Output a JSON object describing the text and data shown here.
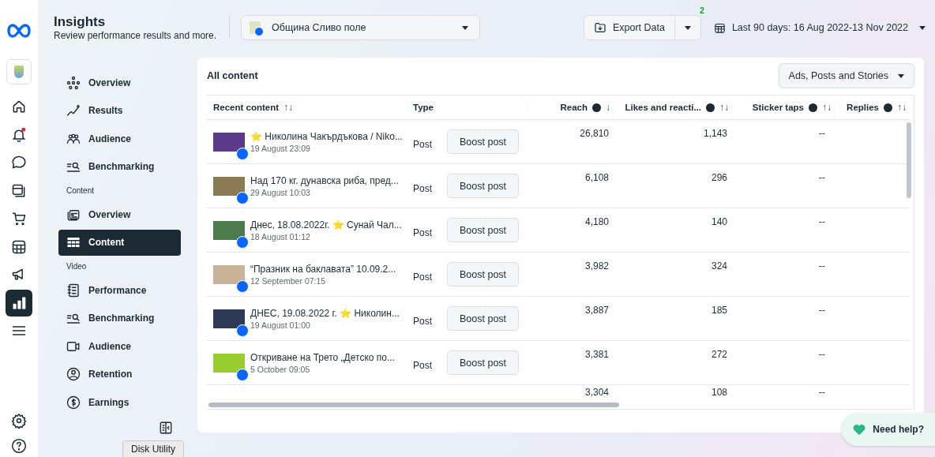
{
  "header": {
    "title": "Insights",
    "subtitle": "Review performance results and more.",
    "page_selector": "Община Сливо поле",
    "export_button": "Export Data",
    "export_badge": "2",
    "date_range": "Last 90 days: 16 Aug 2022-13 Nov 2022"
  },
  "rail": [
    {
      "kind": "logo",
      "selected": false
    },
    {
      "kind": "avatar",
      "selected": false
    },
    {
      "kind": "home",
      "selected": false
    },
    {
      "kind": "bell",
      "selected": false
    },
    {
      "kind": "chat",
      "selected": false
    },
    {
      "kind": "pages",
      "selected": false
    },
    {
      "kind": "cart",
      "selected": false
    },
    {
      "kind": "grid",
      "selected": false
    },
    {
      "kind": "megaphone",
      "selected": false
    },
    {
      "kind": "chart",
      "selected": true
    },
    {
      "kind": "menu",
      "selected": false
    }
  ],
  "rail_bottom": [
    {
      "kind": "settings"
    },
    {
      "kind": "help"
    }
  ],
  "sidebar": {
    "groups": [
      {
        "items": [
          {
            "label": "Overview",
            "selected": false
          },
          {
            "label": "Results",
            "selected": false
          },
          {
            "label": "Audience",
            "selected": false
          },
          {
            "label": "Benchmarking",
            "selected": false
          }
        ]
      },
      {
        "heading": "Content",
        "items": [
          {
            "label": "Overview",
            "selected": false
          },
          {
            "label": "Content",
            "selected": true
          }
        ]
      },
      {
        "heading": "Video",
        "items": [
          {
            "label": "Performance",
            "selected": false
          },
          {
            "label": "Benchmarking",
            "selected": false
          },
          {
            "label": "Audience",
            "selected": false
          },
          {
            "label": "Retention",
            "selected": false
          },
          {
            "label": "Earnings",
            "selected": false
          }
        ]
      }
    ]
  },
  "content": {
    "title": "All content",
    "filter": "Ads, Posts and Stories",
    "columns": [
      {
        "label": "Recent content",
        "info": false,
        "sort": "↑↓",
        "sorted": false
      },
      {
        "label": "Type",
        "info": false
      },
      {
        "label": "Reach",
        "info": true,
        "sort": "↓",
        "sorted": true
      },
      {
        "label": "Likes and reacti...",
        "info": true,
        "sort": "↑↓",
        "sorted": false
      },
      {
        "label": "Sticker taps",
        "info": true,
        "sort": "↑↓",
        "sorted": false
      },
      {
        "label": "Replies",
        "info": true,
        "sort": "↑↓",
        "sorted": false
      }
    ],
    "rows": [
      {
        "title": "⭐ Николина Чакърдъкова / Niko...",
        "date": "19 August 23:09",
        "type": "Post",
        "action": "Boost post",
        "reach": "26,810",
        "likes": "1,143",
        "sticker_taps": "--"
      },
      {
        "title": "Над 170 кг. дунавска риба, пред...",
        "date": "29 August 10:03",
        "type": "Post",
        "action": "Boost post",
        "reach": "6,108",
        "likes": "296",
        "sticker_taps": "--"
      },
      {
        "title": "Днес, 18.08.2022г. ⭐ Сунай Чал...",
        "date": "18 August 01:12",
        "type": "Post",
        "action": "Boost post",
        "reach": "4,180",
        "likes": "140",
        "sticker_taps": "--"
      },
      {
        "title": "“Празник на баклавата” 10.09.2...",
        "date": "12 September 07:15",
        "type": "Post",
        "action": "Boost post",
        "reach": "3,982",
        "likes": "324",
        "sticker_taps": "--"
      },
      {
        "title": "ДНЕС, 19.08.2022 г. ⭐ Николин...",
        "date": "19 August 01:00",
        "type": "Post",
        "action": "Boost post",
        "reach": "3,887",
        "likes": "185",
        "sticker_taps": "--"
      },
      {
        "title": "Откриване на Трето „Детско по...",
        "date": "5 October 09:05",
        "type": "Post",
        "action": "Boost post",
        "reach": "3,381",
        "likes": "272",
        "sticker_taps": "--"
      },
      {
        "reach": "3,304",
        "likes": "108",
        "sticker_taps": "--"
      }
    ]
  },
  "help_button": "Need help?",
  "tooltip": "Disk Utility"
}
